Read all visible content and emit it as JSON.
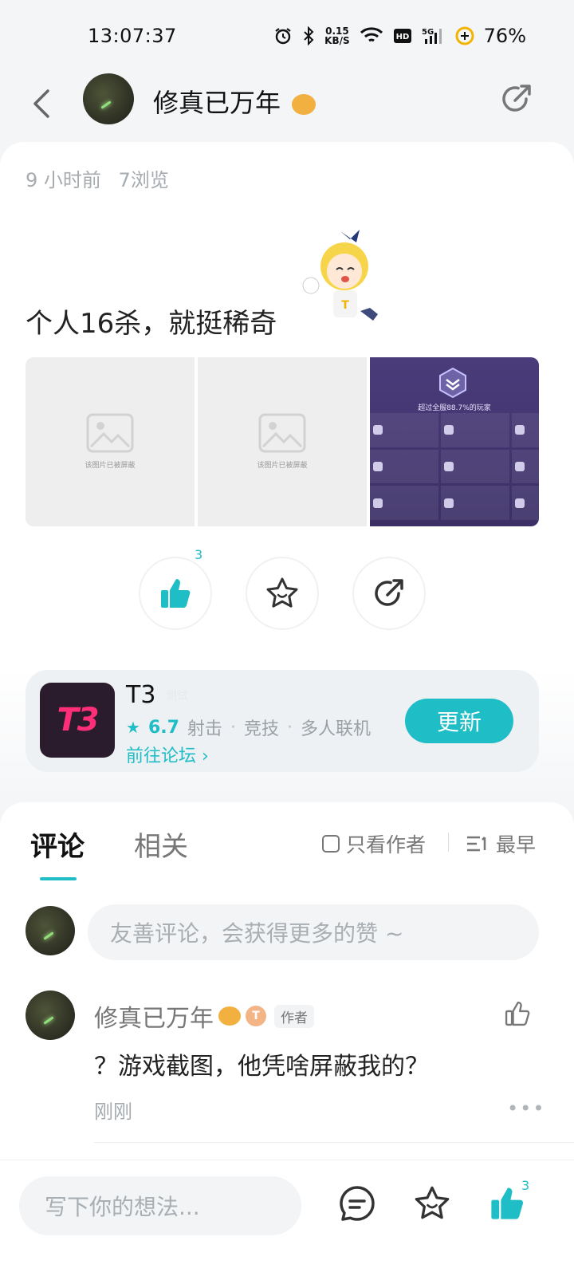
{
  "status": {
    "time": "13:07:37",
    "net_speed_value": "0.15",
    "net_speed_unit": "KB/S",
    "battery": "76%",
    "icons": [
      "alarm-icon",
      "bluetooth-icon",
      "wifi-icon",
      "hd-icon",
      "5g-signal-icon",
      "battery-saver-icon"
    ]
  },
  "topbar": {
    "username": "修真已万年",
    "icons": [
      "back-icon",
      "share-icon"
    ]
  },
  "post": {
    "time": "9 小时前",
    "views": "7浏览",
    "text": "个人16杀，就挺稀奇",
    "images": [
      {
        "type": "blocked",
        "label": "该图片已被屏蔽"
      },
      {
        "type": "blocked",
        "label": "该图片已被屏蔽"
      },
      {
        "type": "game-stats",
        "label": "超过全服88.7%的玩家"
      }
    ],
    "like_count": "3"
  },
  "app": {
    "name": "T3",
    "icon_text": "T3",
    "tag": "测试",
    "rating": "6.7",
    "genres": [
      "射击",
      "竞技",
      "多人联机"
    ],
    "forum_link": "前往论坛",
    "update_button": "更新"
  },
  "comments": {
    "tabs": [
      "评论",
      "相关"
    ],
    "only_author": "只看作者",
    "sort": "最早",
    "input_placeholder": "友善评论，会获得更多的赞 ~",
    "items": [
      {
        "author": "修真已万年",
        "author_tag": "作者",
        "level_badge": "T",
        "text": "？游戏截图，他凭啥屏蔽我的？",
        "time": "刚刚"
      }
    ]
  },
  "bottombar": {
    "input_placeholder": "写下你的想法...",
    "like_count": "3"
  },
  "colors": {
    "accent": "#1fbdc6",
    "background": "#f3f5f7",
    "text_primary": "#222222",
    "text_secondary": "#a6abb0"
  }
}
